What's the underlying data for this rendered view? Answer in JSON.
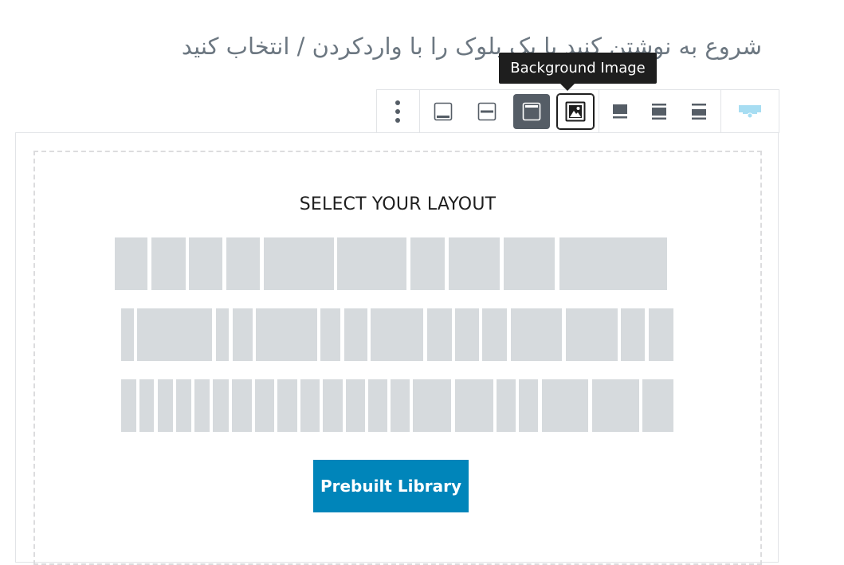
{
  "editor": {
    "placeholder": "شروع به نوشتن کنید یا یک بلوک را با واردکردن / انتخاب کنید"
  },
  "toolbar": {
    "tooltip": "Background Image",
    "buttons": [
      {
        "icon": "more-options-icon",
        "label": "More options"
      },
      {
        "icon": "align-bottom-icon",
        "label": "Align bottom"
      },
      {
        "icon": "align-center-icon",
        "label": "Align middle"
      },
      {
        "icon": "full-height-icon",
        "label": "Full height",
        "active": true
      },
      {
        "icon": "background-image-icon",
        "label": "Background Image",
        "focused": true
      },
      {
        "icon": "vertical-align-top-icon",
        "label": "Vertical align top"
      },
      {
        "icon": "vertical-align-center-icon",
        "label": "Vertical align center"
      },
      {
        "icon": "vertical-align-bottom-icon",
        "label": "Vertical align bottom"
      },
      {
        "icon": "row-block-icon",
        "label": "Row block"
      }
    ]
  },
  "layout_picker": {
    "title": "SELECT YOUR LAYOUT",
    "rows": [
      {
        "name": "layout-row-1",
        "options": [
          "1 column",
          "2 columns",
          "3 columns"
        ]
      },
      {
        "name": "layout-row-2",
        "options": [
          "left sidebar",
          "right sidebar",
          "3 columns",
          "4 columns"
        ]
      },
      {
        "name": "layout-row-3",
        "options": [
          "5 columns",
          "6 columns",
          "grid"
        ]
      }
    ],
    "prebuilt_button": "Prebuilt Library"
  },
  "colors": {
    "tooltip_bg": "#1e1e1e",
    "active_button": "#555d66",
    "layout_placeholder": "#d6dadd",
    "primary_button": "#0085ba"
  }
}
